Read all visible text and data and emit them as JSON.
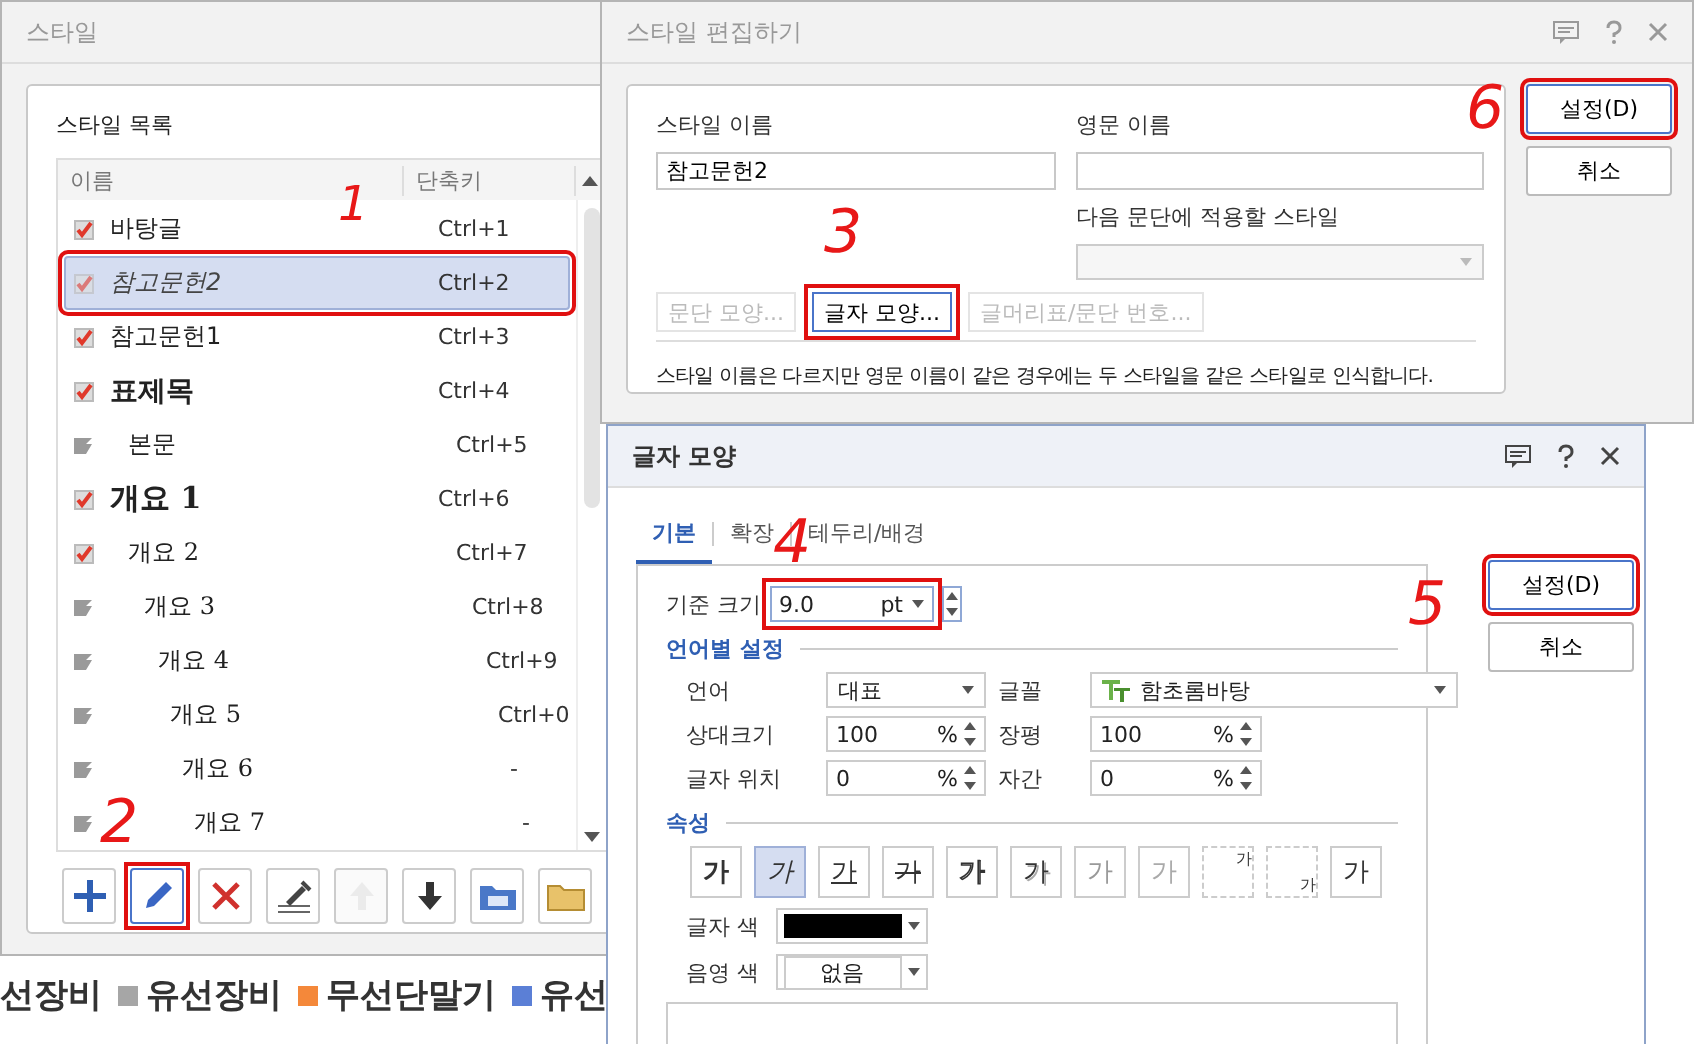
{
  "legend": [
    {
      "label": "선장비"
    },
    {
      "label": "유선장비",
      "color": "#a6a6a6"
    },
    {
      "label": "무선단말기",
      "color": "#f4883a"
    },
    {
      "label": "유선",
      "color": "#5b7fd6"
    }
  ],
  "style_dialog": {
    "title": "스타일",
    "group_label": "스타일 목록",
    "columns": [
      "이름",
      "단축키"
    ],
    "rows": [
      {
        "name": "바탕글",
        "shortcut": "Ctrl+1",
        "kind": "tick",
        "selected": false,
        "highlighted": false
      },
      {
        "name": "참고문헌2",
        "shortcut": "Ctrl+2",
        "kind": "tick",
        "selected": true,
        "highlighted": true,
        "annotation": "1"
      },
      {
        "name": "참고문헌1",
        "shortcut": "Ctrl+3",
        "kind": "tick",
        "selected": false,
        "highlighted": false
      },
      {
        "name": "표제목",
        "shortcut": "Ctrl+4",
        "kind": "tick",
        "selected": false,
        "highlighted": false
      },
      {
        "name": "본문",
        "shortcut": "Ctrl+5",
        "kind": "flag",
        "selected": false,
        "highlighted": false
      },
      {
        "name": "개요 1",
        "shortcut": "Ctrl+6",
        "kind": "tick",
        "selected": false,
        "highlighted": false
      },
      {
        "name": "개요 2",
        "shortcut": "Ctrl+7",
        "kind": "tick",
        "selected": false,
        "highlighted": false
      },
      {
        "name": "개요 3",
        "shortcut": "Ctrl+8",
        "kind": "flag",
        "selected": false,
        "highlighted": false
      },
      {
        "name": "개요 4",
        "shortcut": "Ctrl+9",
        "kind": "flag",
        "selected": false,
        "highlighted": false
      },
      {
        "name": "개요 5",
        "shortcut": "Ctrl+0",
        "kind": "flag",
        "selected": false,
        "highlighted": false
      },
      {
        "name": "개요 6",
        "shortcut": "-",
        "kind": "flag",
        "selected": false,
        "highlighted": false
      },
      {
        "name": "개요 7",
        "shortcut": "-",
        "kind": "flag",
        "selected": false,
        "highlighted": false
      }
    ],
    "toolbar": [
      {
        "kind": "add",
        "disabled": false,
        "highlighted": false
      },
      {
        "kind": "edit",
        "disabled": false,
        "highlighted": true,
        "annotation": "2"
      },
      {
        "kind": "delete",
        "disabled": false,
        "highlighted": false
      },
      {
        "kind": "eyedropper",
        "disabled": false,
        "highlighted": false
      },
      {
        "kind": "up",
        "disabled": true,
        "highlighted": false
      },
      {
        "kind": "down",
        "disabled": false,
        "highlighted": false
      },
      {
        "kind": "folder-text",
        "disabled": false,
        "highlighted": false
      },
      {
        "kind": "folder",
        "disabled": false,
        "highlighted": false
      }
    ]
  },
  "edit_dialog": {
    "title": "스타일 편집하기",
    "name_label": "스타일 이름",
    "name_value": "참고문헌2",
    "english_label": "영문 이름",
    "next_label": "다음 문단에 적용할 스타일",
    "buttons": [
      {
        "label": "문단 모양...",
        "disabled": true,
        "highlighted": false
      },
      {
        "label": "글자 모양...",
        "disabled": false,
        "highlighted": true,
        "annotation": "3"
      },
      {
        "label": "글머리표/문단 번호...",
        "disabled": true,
        "highlighted": false
      }
    ],
    "note": "스타일 이름은 다르지만 영문 이름이 같은 경우에는 두 스타일을 같은 스타일로 인식합니다.",
    "actions": [
      {
        "label": "설정(D)",
        "highlighted": true,
        "annotation": "6"
      },
      {
        "label": "취소",
        "highlighted": false
      }
    ]
  },
  "char_dialog": {
    "title": "글자 모양",
    "tabs": [
      {
        "label": "기본",
        "selected": true
      },
      {
        "label": "확장",
        "selected": false
      },
      {
        "label": "테두리/배경",
        "selected": false
      }
    ],
    "base_size": {
      "label": "기준 크기",
      "value": "9.0",
      "unit": "pt",
      "highlighted": true,
      "annotation": "4"
    },
    "section_language": "언어별 설정",
    "language": {
      "label": "언어",
      "value": "대표"
    },
    "font": {
      "label": "글꼴",
      "value": "함초롬바탕"
    },
    "spins": [
      {
        "label": "상대크기",
        "value": "100",
        "unit": "%"
      },
      {
        "label": "장평",
        "value": "100",
        "unit": "%"
      },
      {
        "label": "글자 위치",
        "value": "0",
        "unit": "%"
      },
      {
        "label": "자간",
        "value": "0",
        "unit": "%"
      }
    ],
    "section_attributes": "속성",
    "attributes": [
      {
        "text": "가",
        "kind": "bold",
        "selected": false
      },
      {
        "text": "가",
        "kind": "italic",
        "selected": true
      },
      {
        "text": "가",
        "kind": "underline",
        "selected": false
      },
      {
        "text": "가",
        "kind": "strike",
        "selected": false
      },
      {
        "text": "가",
        "kind": "outline",
        "selected": false
      },
      {
        "text": "가",
        "kind": "shadow",
        "selected": false
      },
      {
        "text": "가",
        "kind": "emboss",
        "selected": false
      },
      {
        "text": "가",
        "kind": "engrave",
        "selected": false
      },
      {
        "text": "가",
        "kind": "superscript",
        "selected": false
      },
      {
        "text": "가",
        "kind": "subscript",
        "selected": false
      },
      {
        "text": "가",
        "kind": "plain",
        "selected": false
      }
    ],
    "text_color": {
      "label": "글자 색",
      "color": "#000000"
    },
    "shade_color": {
      "label": "음영 색",
      "value": "없음"
    },
    "actions": [
      {
        "label": "설정(D)",
        "highlighted": true,
        "annotation": "5"
      },
      {
        "label": "취소",
        "highlighted": false
      }
    ]
  }
}
